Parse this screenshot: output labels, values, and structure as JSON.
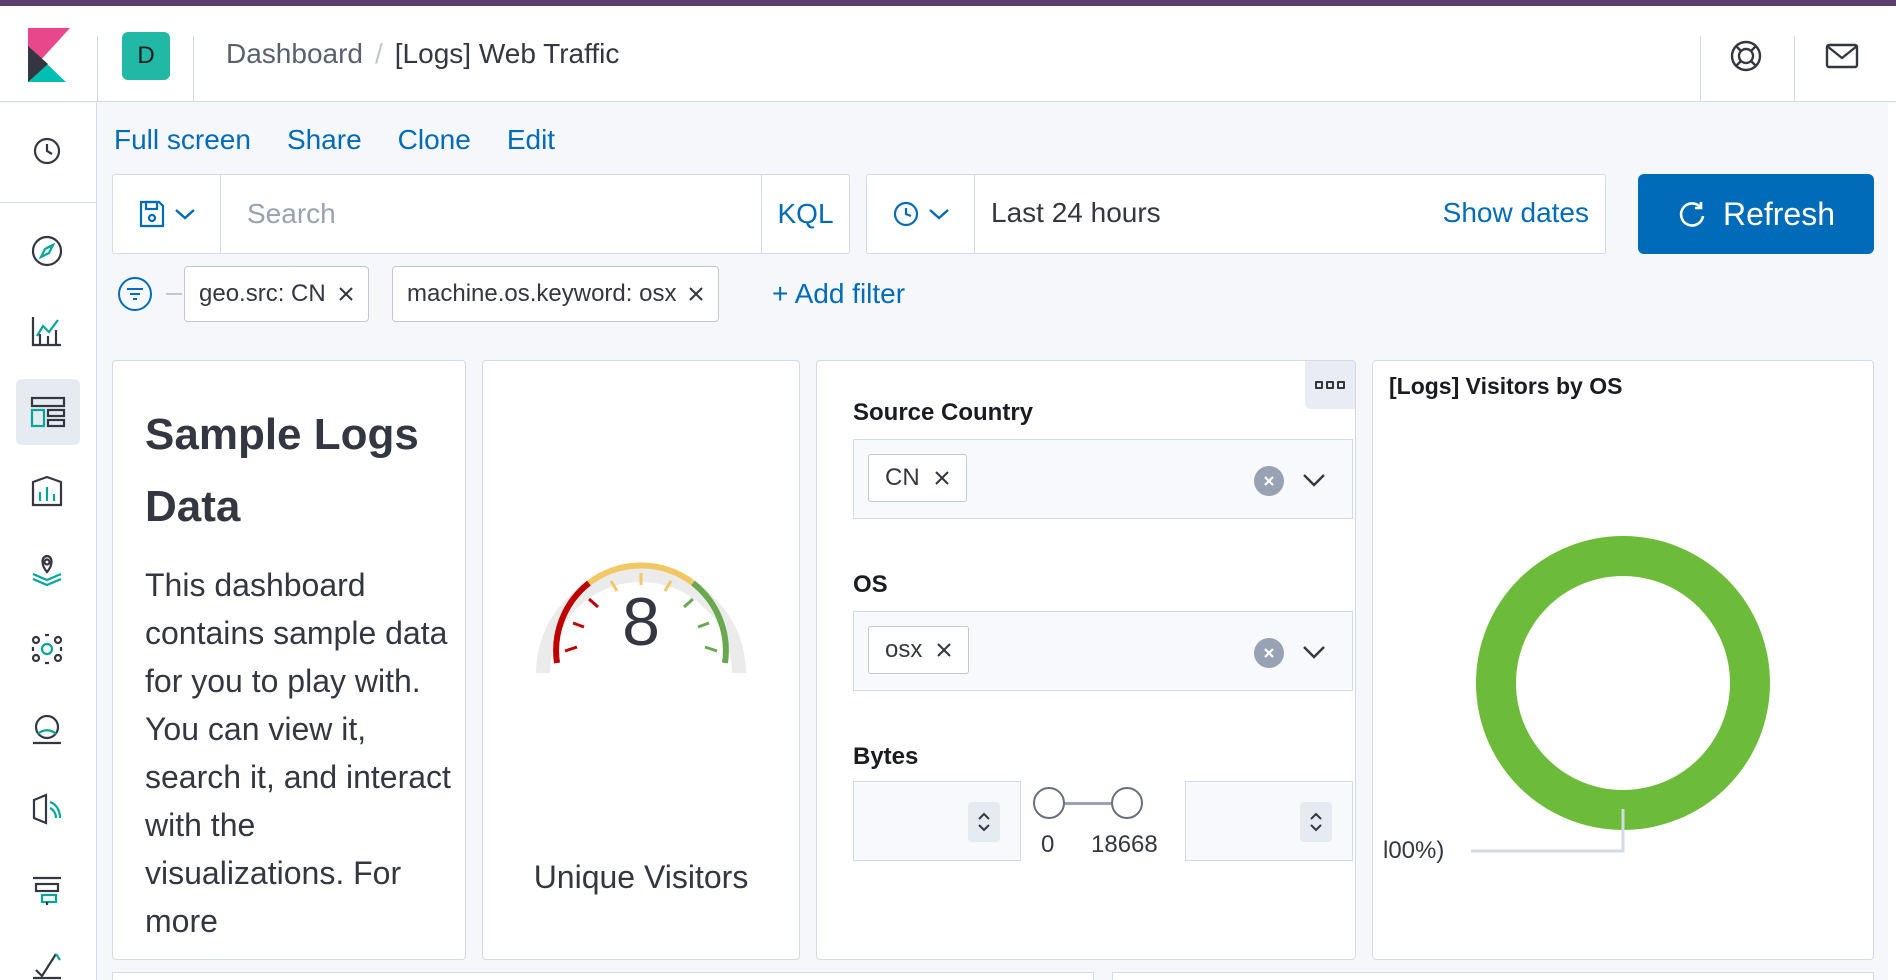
{
  "header": {
    "space_initial": "D",
    "breadcrumb": [
      "Dashboard",
      "[Logs] Web Traffic"
    ]
  },
  "toolbar": {
    "links": [
      "Full screen",
      "Share",
      "Clone",
      "Edit"
    ]
  },
  "query": {
    "placeholder": "Search",
    "language": "KQL"
  },
  "time": {
    "range": "Last 24 hours",
    "show_dates": "Show dates",
    "refresh": "Refresh"
  },
  "filters": {
    "pills": [
      "geo.src: CN",
      "machine.os.keyword: osx"
    ],
    "add": "+ Add filter"
  },
  "markdown_panel": {
    "title": "Sample Logs Data",
    "body": "This dashboard contains sample data for you to play with. You can view it, search it, and interact with the visualizations. For more"
  },
  "gauge_panel": {
    "value": "8",
    "label": "Unique Visitors"
  },
  "controls_panel": {
    "source_country_label": "Source Country",
    "source_country_value": "CN",
    "os_label": "OS",
    "os_value": "osx",
    "bytes_label": "Bytes",
    "bytes_min": "0",
    "bytes_max": "18668"
  },
  "pie_panel": {
    "title": "[Logs] Visitors by OS",
    "slice_label": "l00%)",
    "slice_color": "#6dbb3a"
  },
  "colors": {
    "accent": "#006bb8",
    "teal_badge": "#21b8a6"
  }
}
